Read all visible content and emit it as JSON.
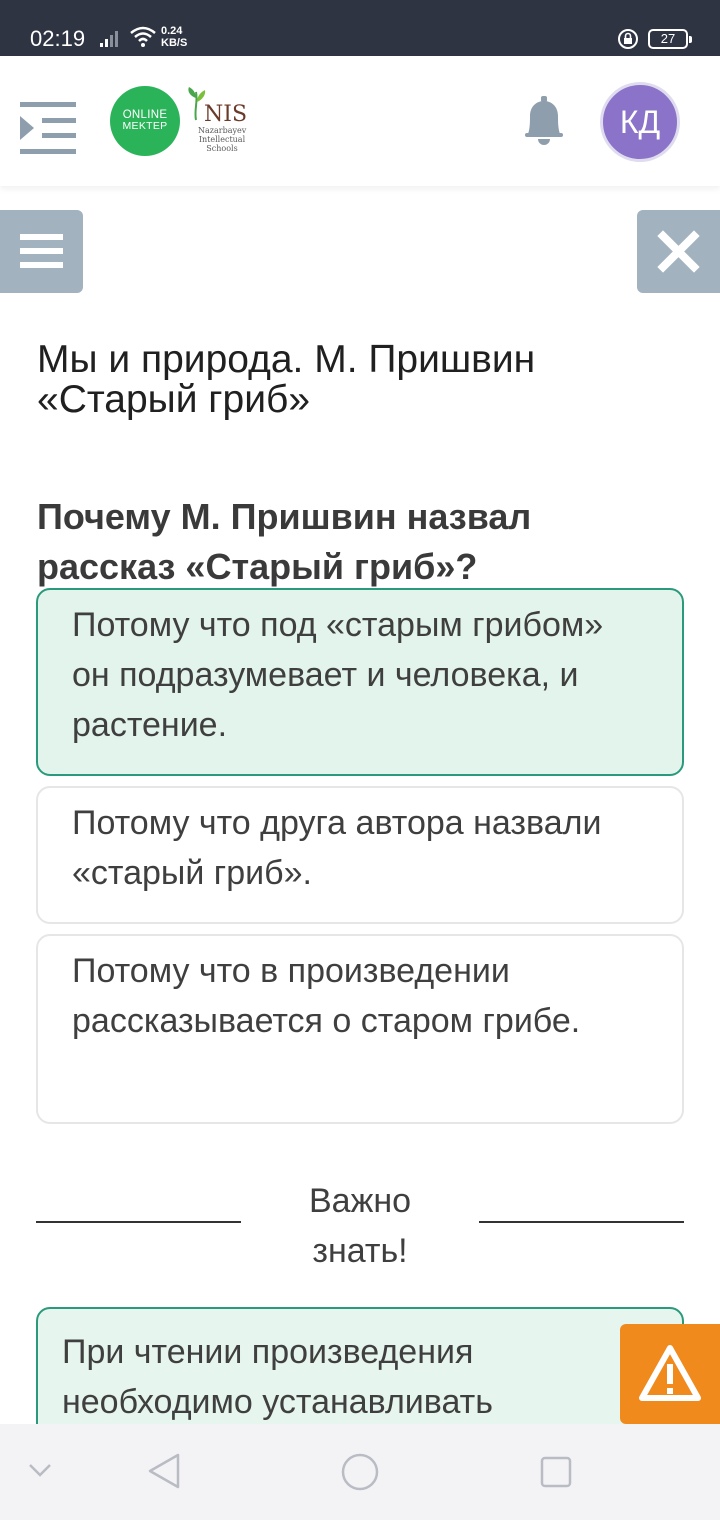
{
  "status_bar": {
    "time": "02:19",
    "net_speed_value": "0.24",
    "net_speed_unit": "KB/S",
    "battery": "27"
  },
  "header": {
    "logo_online_line1": "ONLINE",
    "logo_online_line2": "MEKTEP",
    "logo_nis": "NIS",
    "logo_nis_sub": "Nazarbayev Intellectual Schools",
    "avatar_initials": "КД"
  },
  "lesson": {
    "title": "Мы и природа. М. Пришвин «Старый гриб»"
  },
  "quiz": {
    "question": "Почему М. Пришвин назвал рассказ «Старый гриб»?",
    "options": [
      {
        "text": "Потому что под «старым грибом» он подразумевает и человека, и растение.",
        "selected": true
      },
      {
        "text": "Потому что друга автора назвали «старый гриб».",
        "selected": false
      },
      {
        "text": "Потому что в произведении рассказывается о старом грибе.",
        "selected": false
      }
    ]
  },
  "important": {
    "label": "Важно знать!",
    "text": "При чтении произведения необходимо устанавливать"
  },
  "colors": {
    "status_bar": "#2f3443",
    "accent_green": "#2bb35a",
    "selected_border": "#2b9a7c",
    "selected_bg": "#e3f4ec",
    "toolbar_button": "#a3b2bf",
    "avatar": "#8a73c9",
    "warning": "#f08a1c"
  },
  "icons": {
    "menu_toggle": "menu-indent-icon",
    "bell": "bell-icon",
    "hamburger": "hamburger-icon",
    "close": "close-icon",
    "warning": "warning-triangle-icon",
    "nav": [
      "chevron-down-icon",
      "back-triangle-icon",
      "home-circle-icon",
      "recents-square-icon"
    ]
  }
}
